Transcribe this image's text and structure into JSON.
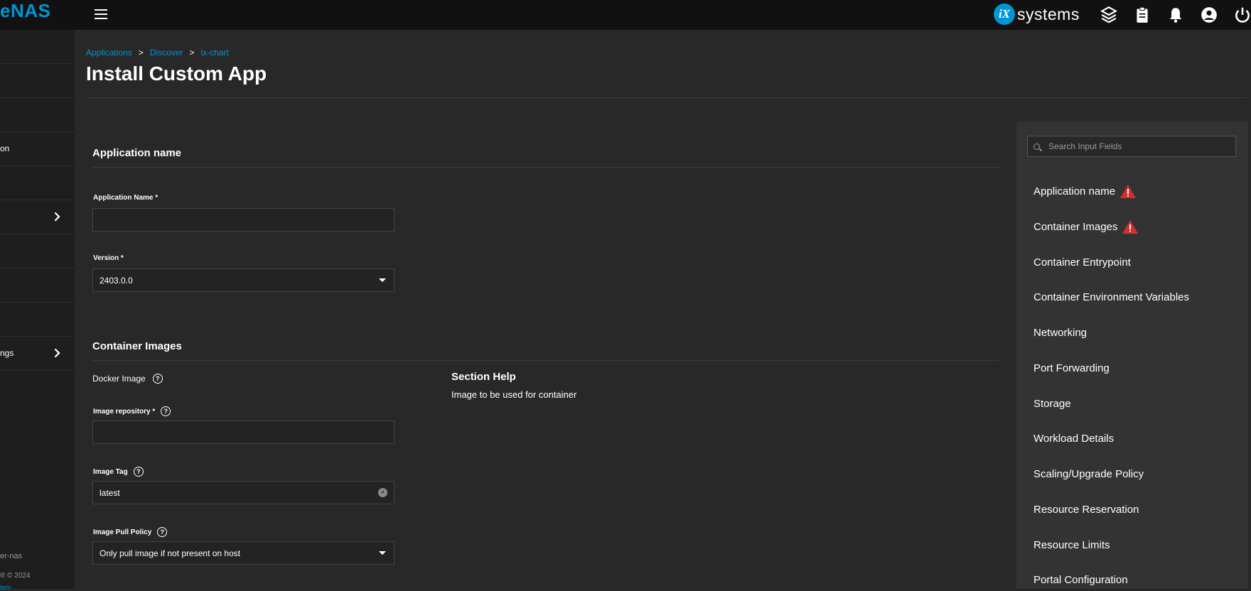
{
  "app": {
    "logo": "eNAS",
    "brand_badge": "iX",
    "brand_name": "systems"
  },
  "topbar_icons": [
    "truecommand-icon",
    "clipboard-icon",
    "bell-icon",
    "account-icon",
    "power-icon"
  ],
  "sidebar": {
    "items": [
      {
        "label": ""
      },
      {
        "label": ""
      },
      {
        "label": ""
      },
      {
        "label": "on"
      },
      {
        "label": ""
      },
      {
        "label": "",
        "has_chevron": true
      },
      {
        "label": ""
      },
      {
        "label": ""
      },
      {
        "label": ""
      },
      {
        "label": "ngs",
        "has_chevron": true
      }
    ],
    "footer_host": "er-nas",
    "footer_copyright": "® © 2024",
    "footer_link": "tem"
  },
  "breadcrumb": {
    "items": [
      "Applications",
      "Discover",
      "ix-chart"
    ],
    "separator": ">"
  },
  "page_title": "Install Custom App",
  "sections": {
    "app_name": {
      "title": "Application name",
      "name_label": "Application Name *",
      "name_value": "",
      "version_label": "Version *",
      "version_value": "2403.0.0"
    },
    "container_images": {
      "title": "Container Images",
      "docker_label": "Docker Image",
      "repo_label": "Image repository *",
      "repo_value": "",
      "tag_label": "Image Tag",
      "tag_value": "latest",
      "pull_label": "Image Pull Policy",
      "pull_value": "Only pull image if not present on host"
    }
  },
  "help": {
    "title": "Section Help",
    "text": "Image to be used for container"
  },
  "search": {
    "placeholder": "Search Input Fields"
  },
  "nav_sections": [
    {
      "label": "Application name",
      "warning": true
    },
    {
      "label": "Container Images",
      "warning": true
    },
    {
      "label": "Container Entrypoint",
      "warning": false
    },
    {
      "label": "Container Environment Variables",
      "warning": false
    },
    {
      "label": "Networking",
      "warning": false
    },
    {
      "label": "Port Forwarding",
      "warning": false
    },
    {
      "label": "Storage",
      "warning": false
    },
    {
      "label": "Workload Details",
      "warning": false
    },
    {
      "label": "Scaling/Upgrade Policy",
      "warning": false
    },
    {
      "label": "Resource Reservation",
      "warning": false
    },
    {
      "label": "Resource Limits",
      "warning": false
    },
    {
      "label": "Portal Configuration",
      "warning": false
    }
  ],
  "colors": {
    "accent": "#0095d5",
    "warning": "#d32f2f",
    "background": "#282828",
    "topbar": "#111111",
    "panel": "#333333"
  }
}
